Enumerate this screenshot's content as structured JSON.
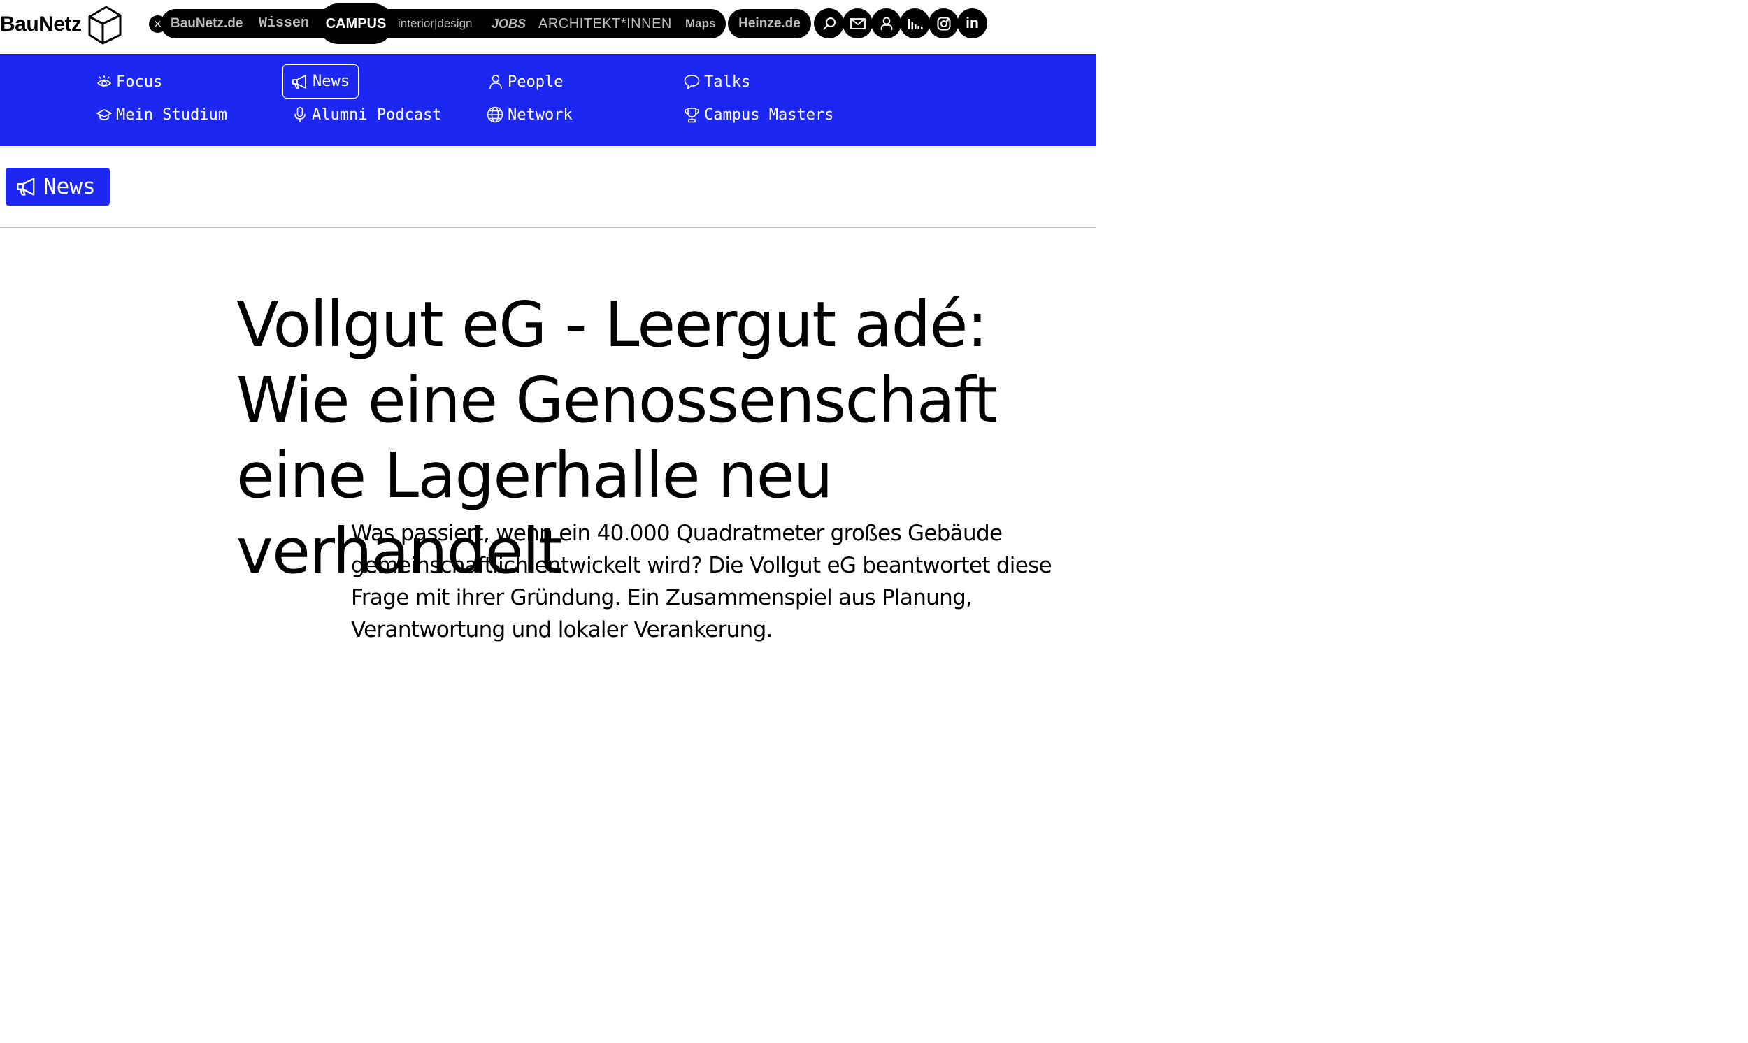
{
  "logo": {
    "text": "BauNetz",
    "icon": "cube-icon"
  },
  "topbar": {
    "close_icon": "close-icon",
    "close_glyph": "×",
    "sites": {
      "baunetz": "BauNetz.de",
      "wissen": "Wissen",
      "campus": "CAMPUS",
      "interior": "interior|design",
      "jobs": "JOBS",
      "architekt": "ARCHITEKT*INNEN",
      "maps": "Maps",
      "heinze": "Heinze.de"
    },
    "active_site": "CAMPUS",
    "icons": [
      "search-icon",
      "mail-icon",
      "user-icon",
      "chart-icon",
      "instagram-icon",
      "linkedin-icon"
    ],
    "linkedin_text": "in"
  },
  "campus_nav": {
    "background": "#1c28f2",
    "items": [
      {
        "label": "Focus",
        "icon": "eye-icon"
      },
      {
        "label": "Mein Studium",
        "icon": "graduation-cap-icon"
      },
      {
        "label": "News",
        "icon": "megaphone-icon",
        "active": true
      },
      {
        "label": "Alumni Podcast",
        "icon": "microphone-icon"
      },
      {
        "label": "People",
        "icon": "person-icon"
      },
      {
        "label": "Network",
        "icon": "globe-icon"
      },
      {
        "label": "Talks",
        "icon": "speech-bubble-icon"
      },
      {
        "label": "Campus Masters",
        "icon": "trophy-icon"
      }
    ]
  },
  "section": {
    "label": "News",
    "icon": "megaphone-icon"
  },
  "article": {
    "headline": "Vollgut eG - Leergut adé: Wie eine Genossenschaft eine Lagerhalle neu verhandelt",
    "lead": "Was passiert, wenn ein 40.000 Quadratmeter großes Gebäude gemeinschaftlich entwickelt wird? Die Vollgut eG beantwortet diese Frage mit ihrer Gründung. Ein Zusammenspiel aus Planung, Verantwortung und lokaler Verankerung."
  }
}
